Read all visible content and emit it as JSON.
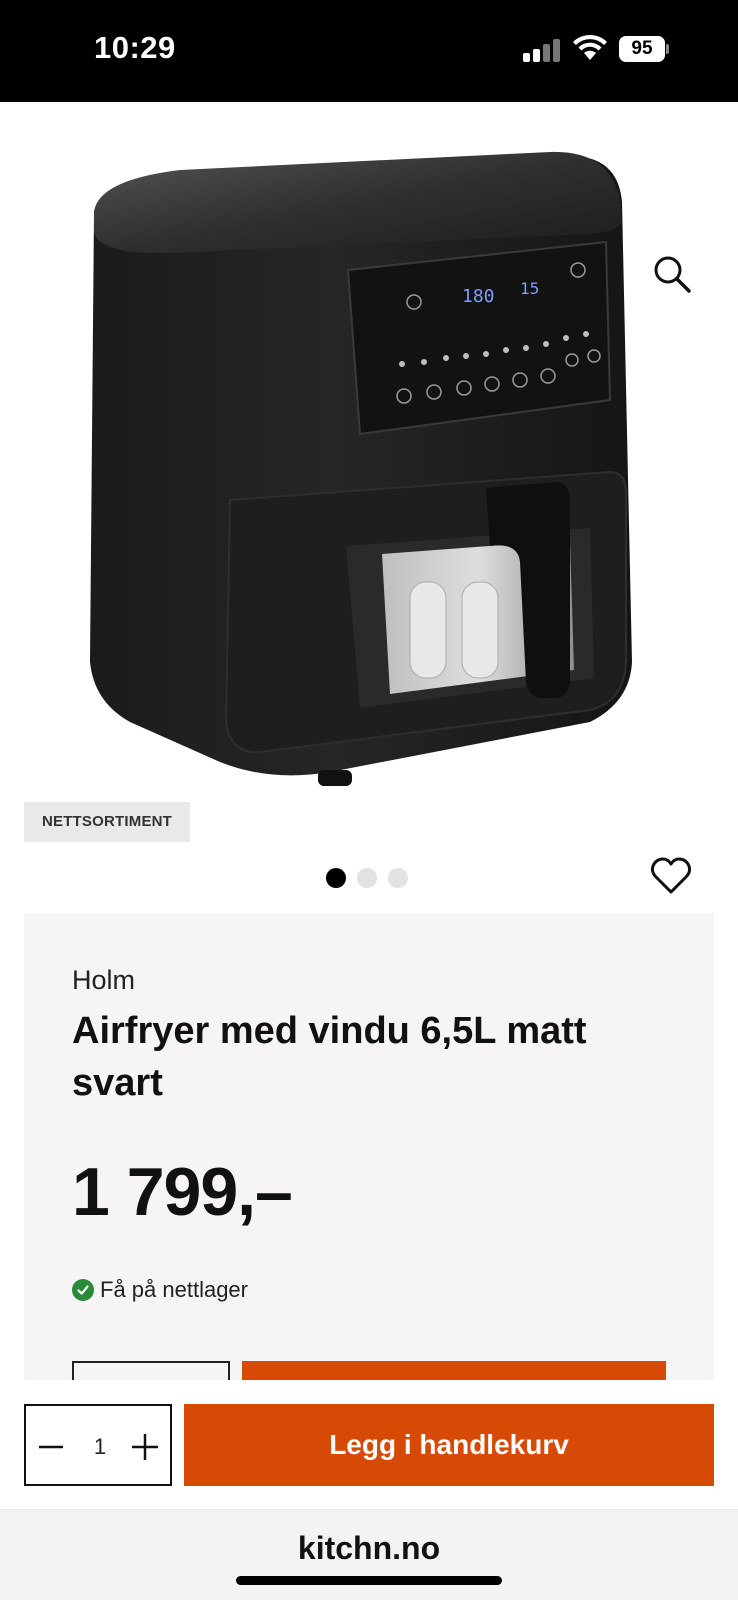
{
  "status_bar": {
    "time": "10:29",
    "battery": "95"
  },
  "gallery": {
    "badge": "NETTSORTIMENT",
    "slide_count": 3,
    "active_slide": 1
  },
  "product": {
    "brand": "Holm",
    "title": "Airfryer med vindu 6,5L matt svart",
    "price": "1 799,–",
    "stock": "Få på nettlager",
    "display_temp": "180",
    "display_time": "15"
  },
  "cart_bar": {
    "quantity": "1",
    "add_label": "Legg i handlekurv"
  },
  "browser": {
    "url": "kitchn.no"
  },
  "colors": {
    "accent": "#d64a06",
    "stock_ok": "#2a8a3a"
  },
  "icons": {
    "search": "search-icon",
    "wishlist": "heart-icon",
    "minus": "minus-icon",
    "plus": "plus-icon",
    "stock": "check-circle-icon"
  }
}
